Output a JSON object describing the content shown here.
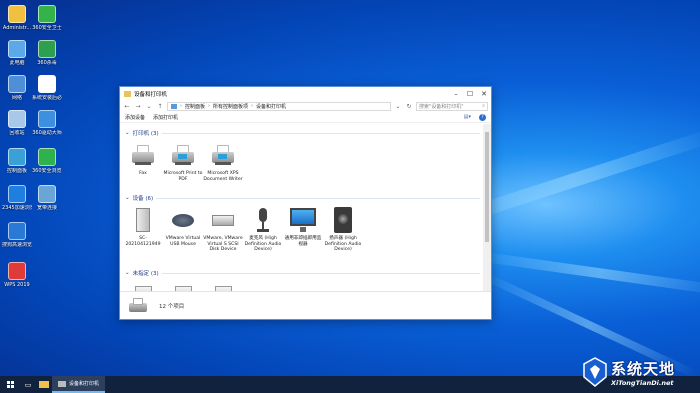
{
  "desktop_icons": [
    {
      "label": "Administr...",
      "color": "#f0c040"
    },
    {
      "label": "360安全卫士",
      "color": "#34b34a"
    },
    {
      "label": "此电脑",
      "color": "#5da8e8"
    },
    {
      "label": "360杀毒",
      "color": "#2e9e4f"
    },
    {
      "label": "网络",
      "color": "#4f8fd8"
    },
    {
      "label": "系统安装后必读.docx",
      "color": "#ffffff"
    },
    {
      "label": "回收站",
      "color": "#a7c8e8"
    },
    {
      "label": "360驱动大师",
      "color": "#3f8fe0"
    },
    {
      "label": "控制面板",
      "color": "#3aa0d8"
    },
    {
      "label": "360安全浏览器",
      "color": "#2fb14d"
    },
    {
      "label": "2345加速浏览器",
      "color": "#1e7fe0"
    },
    {
      "label": "宽带连接",
      "color": "#6aa5d8"
    },
    {
      "label": "搜狗高速浏览器",
      "color": "#2a79d4"
    },
    {
      "label": "WPS 2019",
      "color": "#e03b3b"
    }
  ],
  "window": {
    "title": "设备和打印机",
    "address": [
      "控制面板",
      "所有控制面板项",
      "设备和打印机"
    ],
    "search_placeholder": "搜索\"设备和打印机\"",
    "commands": [
      "添加设备",
      "添加打印机"
    ],
    "groups": {
      "printers": {
        "label": "打印机 (3)"
      },
      "devices": {
        "label": "设备 (6)"
      },
      "unspecified": {
        "label": "未指定 (3)"
      }
    },
    "printers": [
      {
        "label": "Fax"
      },
      {
        "label": "Microsoft Print to PDF"
      },
      {
        "label": "Microsoft XPS Document Writer"
      }
    ],
    "devices": [
      {
        "label": "SC-202104121949"
      },
      {
        "label": "VMware Virtual USB Mouse"
      },
      {
        "label": "VMware, VMware Virtual S SCSI Disk Device"
      },
      {
        "label": "麦克风 (High Definition Audio Device)"
      },
      {
        "label": "通用非即插即用监视器"
      },
      {
        "label": "扬声器 (High Definition Audio Device)"
      }
    ],
    "status": "12 个项目"
  },
  "taskbar": {
    "active_app": "设备和打印机"
  },
  "watermark": {
    "cn": "系统天地",
    "en": "XiTongTianDi.net"
  }
}
